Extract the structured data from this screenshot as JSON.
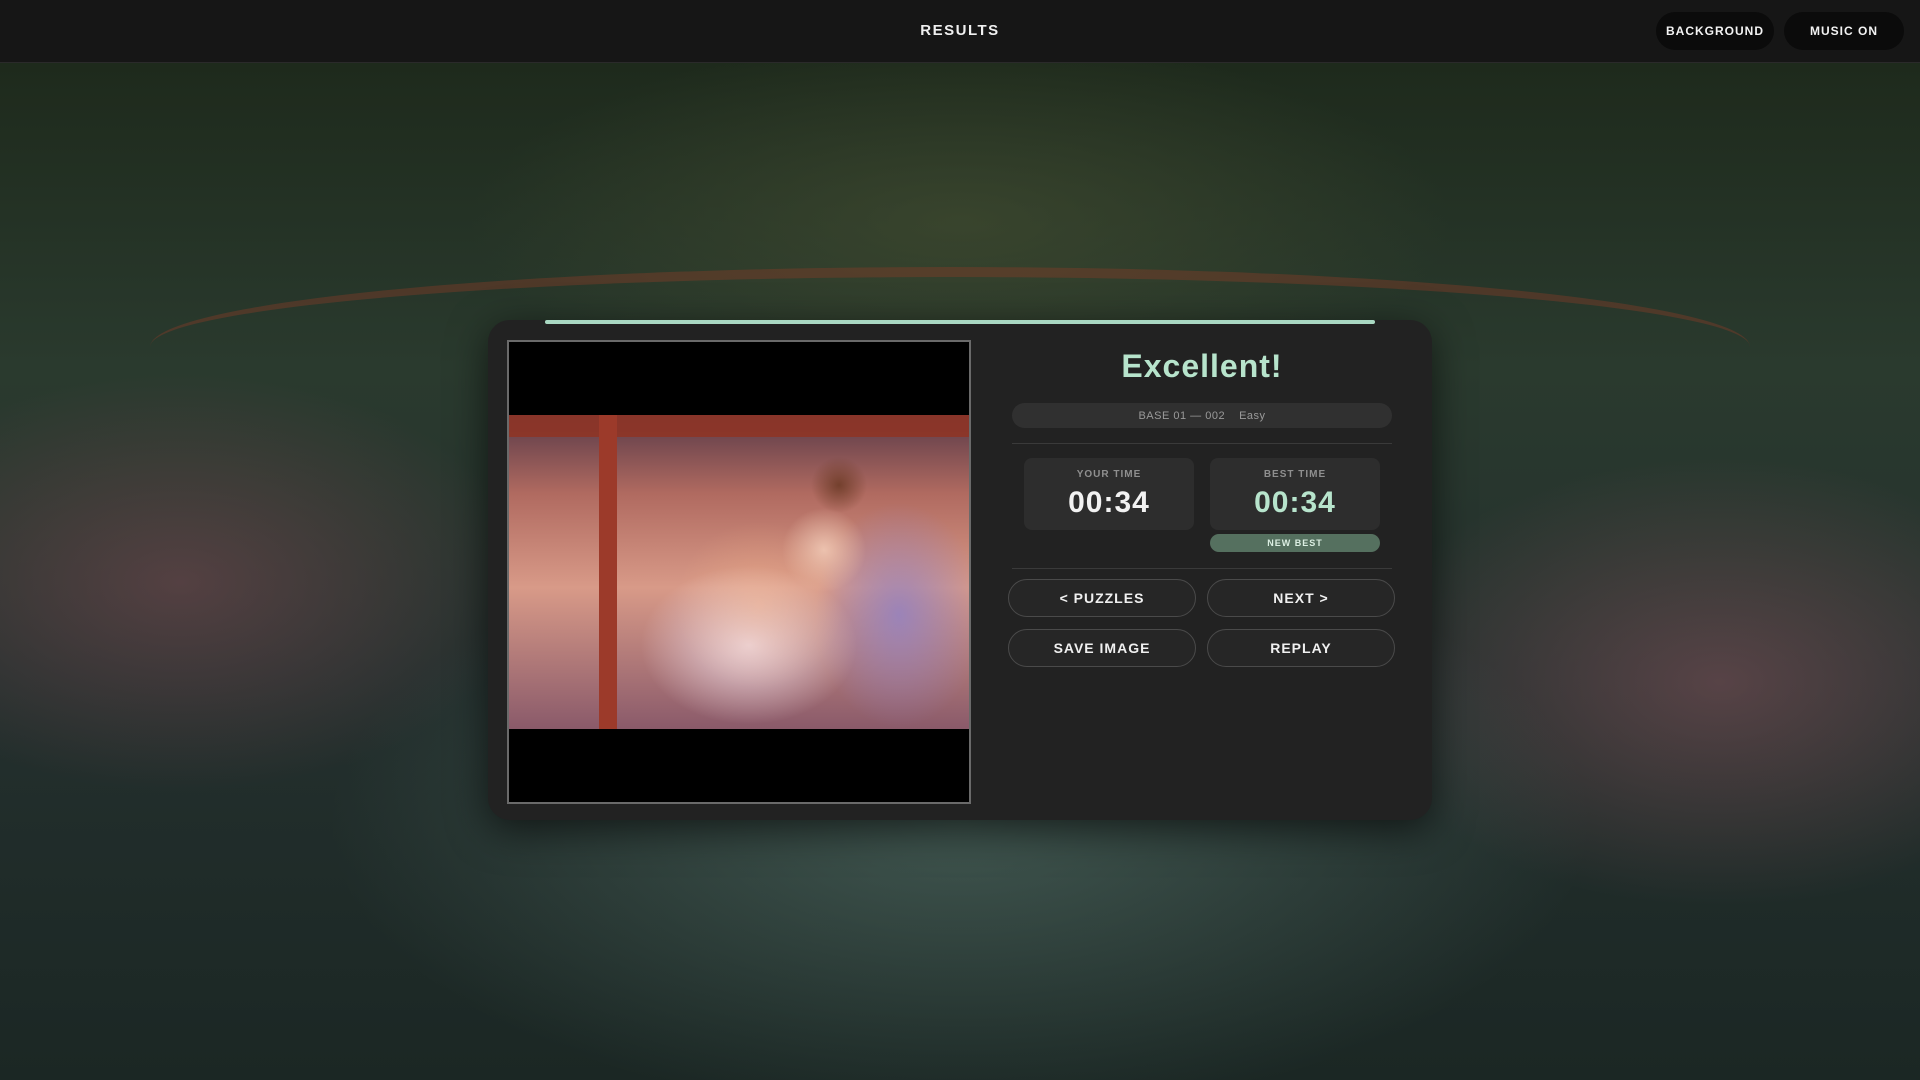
{
  "header": {
    "title": "RESULTS",
    "background_label": "BACKGROUND",
    "music_label": "MUSIC ON"
  },
  "result": {
    "heading": "Excellent!",
    "puzzle_id": "BASE 01 — 002",
    "difficulty": "Easy",
    "your_time_label": "YOUR TIME",
    "your_time": "00:34",
    "best_time_label": "BEST TIME",
    "best_time": "00:34",
    "new_best_label": "NEW BEST"
  },
  "actions": {
    "puzzles": "< PUZZLES",
    "next": "NEXT >",
    "save_image": "SAVE IMAGE",
    "replay": "REPLAY"
  },
  "colors": {
    "accent": "#b7e4cc",
    "card": "#222222",
    "badge": "#55705f"
  }
}
